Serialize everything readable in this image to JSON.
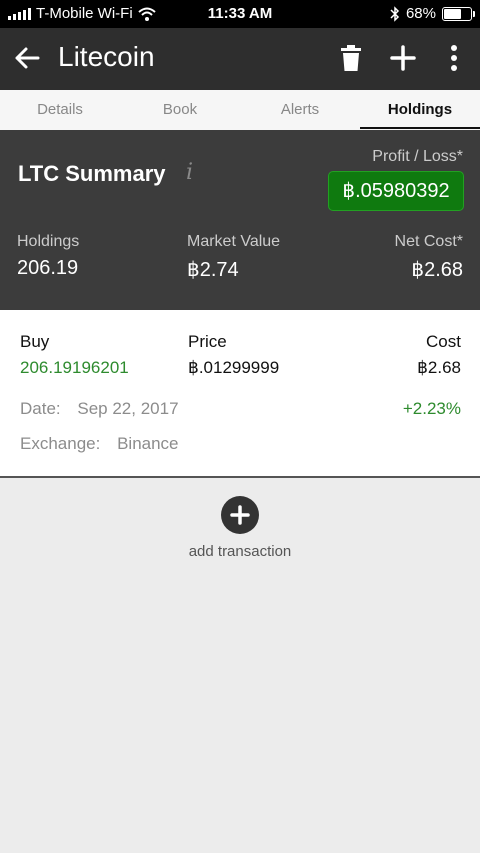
{
  "status_bar": {
    "carrier": "T-Mobile Wi-Fi",
    "time": "11:33 AM",
    "battery": "68%",
    "battery_level": 0.68
  },
  "app_bar": {
    "title": "Litecoin",
    "icons": [
      "back-arrow-icon",
      "trash-icon",
      "plus-icon",
      "more-vert-icon"
    ]
  },
  "tabs": [
    {
      "label": "Details",
      "active": false
    },
    {
      "label": "Book",
      "active": false
    },
    {
      "label": "Alerts",
      "active": false
    },
    {
      "label": "Holdings",
      "active": true
    }
  ],
  "summary": {
    "title": "LTC Summary",
    "info_glyph": "i",
    "profit_loss_label": "Profit / Loss*",
    "profit_loss_value": "฿.05980392",
    "profit_loss_color": "#0f7a0f",
    "holdings_label": "Holdings",
    "holdings_value": "206.19",
    "market_value_label": "Market Value",
    "market_value_value": "฿2.74",
    "net_cost_label": "Net Cost*",
    "net_cost_value": "฿2.68"
  },
  "holding": {
    "type_label": "Buy",
    "amount": "206.19196201",
    "price_label": "Price",
    "price_value": "฿.01299999",
    "cost_label": "Cost",
    "cost_value": "฿2.68",
    "date_label": "Date:",
    "date_value": "Sep 22, 2017",
    "change": "+2.23%",
    "exchange_label": "Exchange:",
    "exchange_value": "Binance",
    "positive_color": "#2e8b2e"
  },
  "add_transaction": {
    "label": "add transaction",
    "icon": "add-circle-icon"
  }
}
